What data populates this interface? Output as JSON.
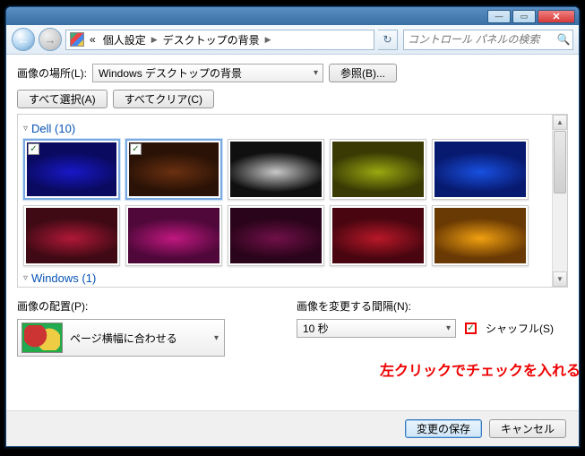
{
  "breadcrumb": {
    "prefix": "«",
    "level1": "個人設定",
    "level2": "デスクトップの背景"
  },
  "search": {
    "placeholder": "コントロール パネルの検索"
  },
  "location": {
    "label": "画像の場所(L):",
    "value": "Windows デスクトップの背景",
    "browse": "参照(B)..."
  },
  "select": {
    "all": "すべて選択(A)",
    "clear": "すべてクリア(C)"
  },
  "groups": [
    {
      "name": "Dell (10)",
      "items": [
        {
          "color1": "#0a0a60",
          "color2": "#1818c8",
          "checked": true,
          "selected": true
        },
        {
          "color1": "#2a1206",
          "color2": "#6a3010",
          "checked": true,
          "selected": true
        },
        {
          "color1": "#101010",
          "color2": "#c8c8c8",
          "checked": false,
          "selected": false
        },
        {
          "color1": "#3a3a04",
          "color2": "#9aa810",
          "checked": false,
          "selected": false
        },
        {
          "color1": "#081a70",
          "color2": "#1850e0",
          "checked": false,
          "selected": false
        },
        {
          "color1": "#400a14",
          "color2": "#b01838",
          "checked": false,
          "selected": false
        },
        {
          "color1": "#50083a",
          "color2": "#c01880",
          "checked": false,
          "selected": false
        },
        {
          "color1": "#2a041a",
          "color2": "#701048",
          "checked": false,
          "selected": false
        },
        {
          "color1": "#4a0610",
          "color2": "#b81828",
          "checked": false,
          "selected": false
        },
        {
          "color1": "#6a3a04",
          "color2": "#f0a010",
          "checked": false,
          "selected": false
        }
      ]
    },
    {
      "name": "Windows (1)",
      "items": []
    }
  ],
  "position": {
    "label": "画像の配置(P):",
    "value": "ページ横幅に合わせる"
  },
  "interval": {
    "label": "画像を変更する間隔(N):",
    "value": "10 秒"
  },
  "shuffle": {
    "label": "シャッフル(S)",
    "checked": true
  },
  "annotation": "左クリックでチェックを入れる",
  "footer": {
    "save": "変更の保存",
    "cancel": "キャンセル"
  }
}
